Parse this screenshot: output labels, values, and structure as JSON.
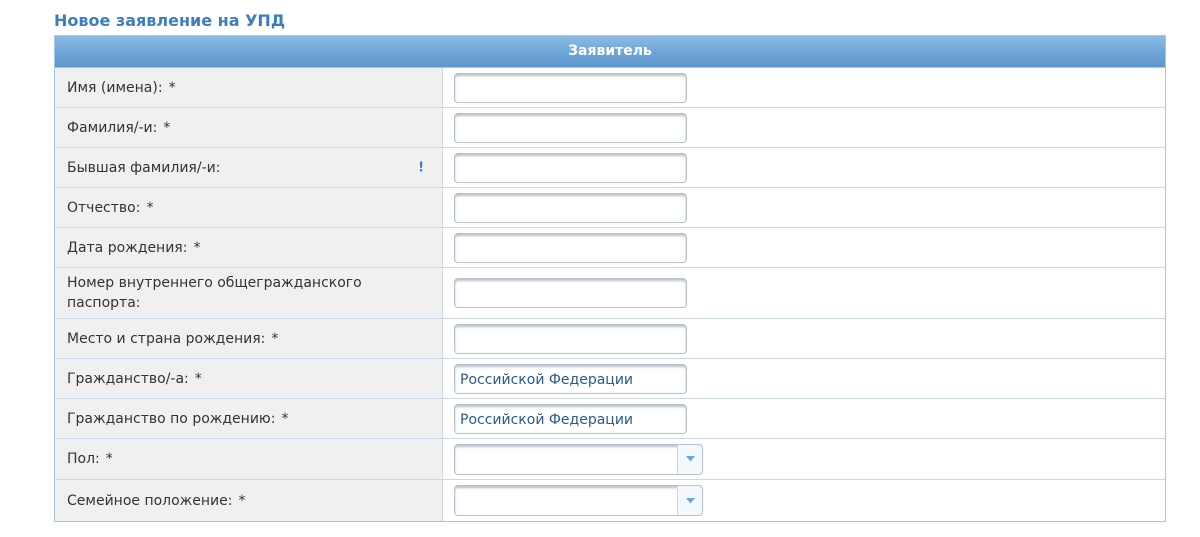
{
  "page": {
    "title": "Новое заявление на УПД"
  },
  "section": {
    "header": "Заявитель"
  },
  "fields": [
    {
      "label": "Имя (имена):",
      "required": "*",
      "value": ""
    },
    {
      "label": "Фамилия/-и:",
      "required": "*",
      "value": ""
    },
    {
      "label": "Бывшая фамилия/-и:",
      "required": "",
      "info": "!",
      "value": ""
    },
    {
      "label": "Отчество:",
      "required": "*",
      "value": ""
    },
    {
      "label": "Дата рождения:",
      "required": "*",
      "value": ""
    },
    {
      "label": "Номер внутреннего общегражданского паспорта:",
      "required": "",
      "value": ""
    },
    {
      "label": "Место и страна рождения:",
      "required": "*",
      "value": ""
    },
    {
      "label": "Гражданство/-а:",
      "required": "*",
      "value": "Российской Федерации"
    },
    {
      "label": "Гражданство по рождению:",
      "required": "*",
      "value": "Российской Федерации"
    },
    {
      "label": "Пол:",
      "required": "*",
      "value": ""
    },
    {
      "label": "Семейное положение:",
      "required": "*",
      "value": ""
    }
  ],
  "colors": {
    "title": "#3d7ec0",
    "header_bg": "#6fa6d8",
    "label_bg": "#f0f0f0",
    "border": "#c9d9ea",
    "value_text": "#2a5a8c"
  },
  "icons": {
    "dropdown": "chevron-down-icon",
    "info": "exclamation-icon"
  }
}
